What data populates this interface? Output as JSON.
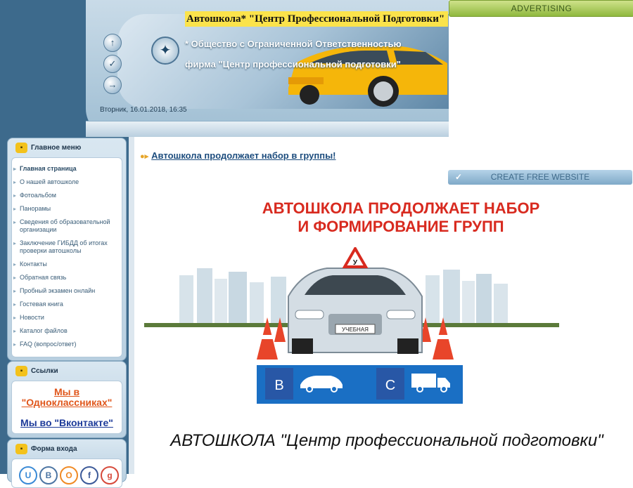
{
  "header": {
    "site_title": "Автошкола* \"Центр Профессиональной Подготовки\"",
    "org_line1": "* Общество с Ограниченной Ответственностью",
    "org_line2": "фирма \"Центр профессиональной подготовки\"",
    "datetime": "Вторник, 16.01.2018, 16:35",
    "nav_icons": [
      "up-arrow-icon",
      "check-icon",
      "login-icon"
    ]
  },
  "ads": {
    "advertising_label": "ADVERTISING",
    "create_label": "CREATE FREE WEBSITE"
  },
  "main_menu": {
    "title": "Главное меню",
    "items": [
      {
        "label": "Главная страница",
        "active": true
      },
      {
        "label": "О нашей автошколе"
      },
      {
        "label": "Фотоальбом"
      },
      {
        "label": "Панорамы"
      },
      {
        "label": "Сведения об образовательной организации"
      },
      {
        "label": "Заключение ГИБДД об итогах проверки автошколы"
      },
      {
        "label": "Контакты"
      },
      {
        "label": "Обратная связь"
      },
      {
        "label": "Пробный экзамен онлайн"
      },
      {
        "label": "Гостевая книга"
      },
      {
        "label": "Новости"
      },
      {
        "label": "Каталог файлов"
      },
      {
        "label": "FAQ (вопрос/ответ)"
      }
    ]
  },
  "links_panel": {
    "title": "Ссылки",
    "ok_label": "Мы в \"Одноклассниках\"",
    "vk_label": "Мы во \"Вконтакте\""
  },
  "login_panel": {
    "title": "Форма входа",
    "social_icons": [
      {
        "name": "ucoz-icon",
        "glyph": "U",
        "color": "#3a8ad6"
      },
      {
        "name": "vk-icon",
        "glyph": "В",
        "color": "#4c75a3"
      },
      {
        "name": "odnoklassniki-icon",
        "glyph": "O",
        "color": "#f08a24"
      },
      {
        "name": "facebook-icon",
        "glyph": "f",
        "color": "#3b5998"
      },
      {
        "name": "google-icon",
        "glyph": "g",
        "color": "#d6493a"
      }
    ]
  },
  "main": {
    "breadcrumb_link": "Автошкола продолжает набор в группы!",
    "promo_title_line1": "АВТОШКОЛА ПРОДОЛЖАЕТ НАБОР",
    "promo_title_line2": "И ФОРМИРОВАНИЕ ГРУПП",
    "car_plate": "УЧЕБНАЯ",
    "sign_letter": "У",
    "category_b": "B",
    "category_c": "C",
    "footer_title": "АВТОШКОЛА \"Центр профессиональной подготовки\""
  },
  "colors": {
    "sidebar_bg": "#3d6a8c",
    "title_highlight": "#fbe34b",
    "promo_red": "#d82a1f",
    "category_blue": "#1a6fc4"
  }
}
